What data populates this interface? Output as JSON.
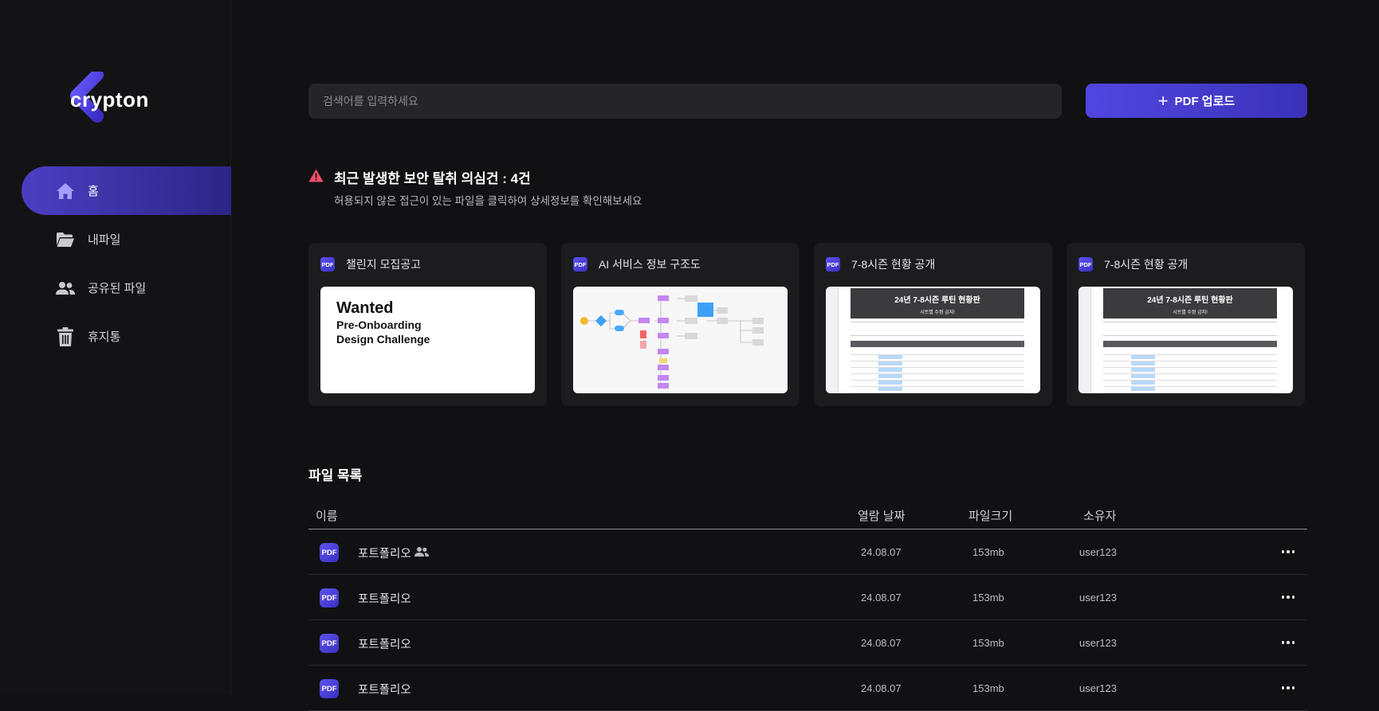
{
  "app": {
    "logo_text": "crypton"
  },
  "sidebar": {
    "items": [
      {
        "label": "홈",
        "icon": "home-icon",
        "active": true
      },
      {
        "label": "내파일",
        "icon": "folder-icon",
        "active": false
      },
      {
        "label": "공유된 파일",
        "icon": "people-icon",
        "active": false
      },
      {
        "label": "휴지통",
        "icon": "trash-icon",
        "active": false
      }
    ]
  },
  "search": {
    "placeholder": "검색어를 입력하세요"
  },
  "upload": {
    "label": "PDF 업로드",
    "icon": "plus-icon"
  },
  "alert": {
    "title": "최근 발생한 보안 탈취 의심건 : 4건",
    "subtitle": "허용되지 않은 접근이 있는 파일을 클릭하여 상세정보를 확인해보세요",
    "icon": "warning-icon",
    "color": "#f0506e"
  },
  "cards": [
    {
      "title": "챌린지 모집공고",
      "badge": "PDF",
      "thumb": {
        "line1": "Wanted",
        "line2": "Pre-Onboarding",
        "line3": "Design Challenge"
      }
    },
    {
      "title": "AI 서비스 정보 구조도",
      "badge": "PDF"
    },
    {
      "title": "7-8시즌 현황 공개",
      "badge": "PDF",
      "thumb": {
        "heading": "24년 7-8시즌 루틴 현황판",
        "sub": "시트별 수정 금지!"
      }
    },
    {
      "title": "7-8시즌 현황 공개",
      "badge": "PDF",
      "thumb": {
        "heading": "24년 7-8시즌 루틴 현황판",
        "sub": "시트별 수정 금지!"
      }
    }
  ],
  "file_list": {
    "title": "파일 목록",
    "columns": {
      "name": "이름",
      "date": "열람 날짜",
      "size": "파일크기",
      "owner": "소유자"
    },
    "rows": [
      {
        "badge": "PDF",
        "name": "포트폴리오",
        "shared": true,
        "date": "24.08.07",
        "size": "153mb",
        "owner": "user123"
      },
      {
        "badge": "PDF",
        "name": "포트폴리오",
        "shared": false,
        "date": "24.08.07",
        "size": "153mb",
        "owner": "user123"
      },
      {
        "badge": "PDF",
        "name": "포트폴리오",
        "shared": false,
        "date": "24.08.07",
        "size": "153mb",
        "owner": "user123"
      },
      {
        "badge": "PDF",
        "name": "포트폴리오",
        "shared": false,
        "date": "24.08.07",
        "size": "153mb",
        "owner": "user123"
      }
    ]
  },
  "colors": {
    "accent": "#4b3fc2",
    "background": "#111113",
    "card": "#1c1c1e"
  }
}
